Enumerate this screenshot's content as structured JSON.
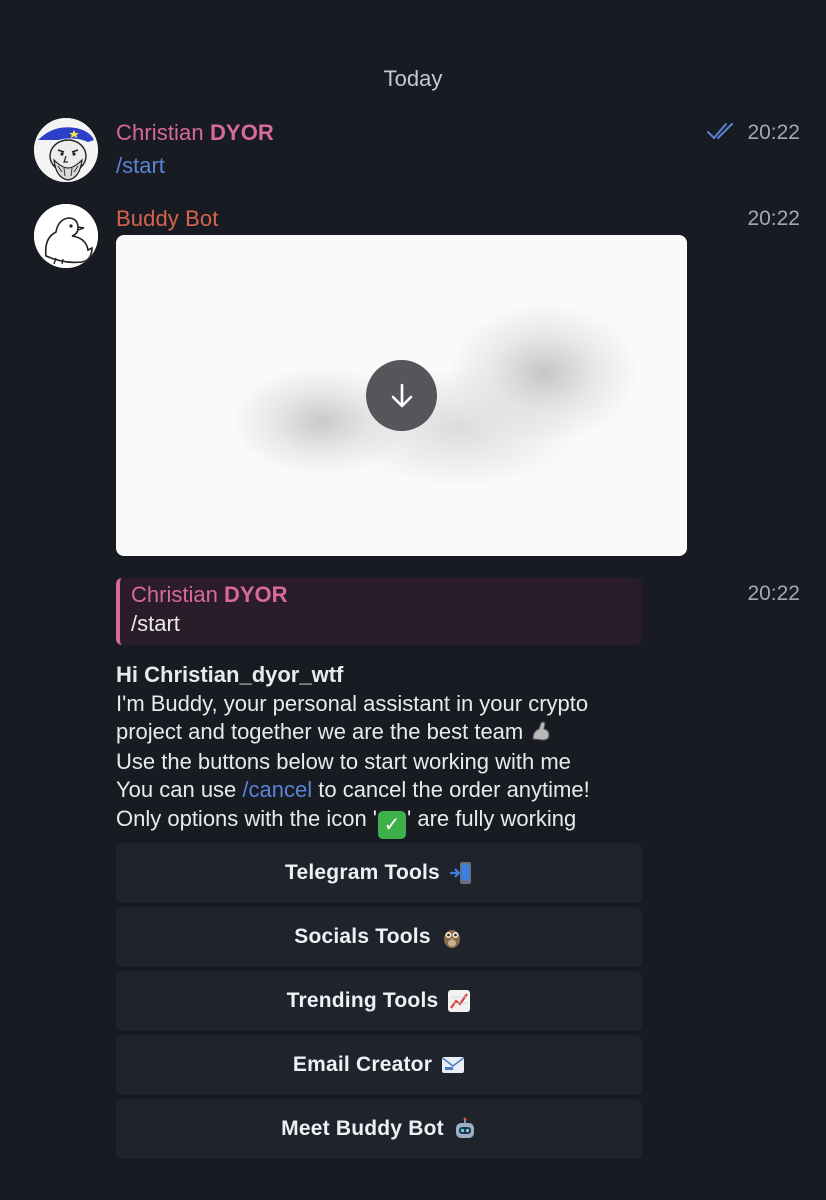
{
  "date_separator": "Today",
  "messages": [
    {
      "sender_name": "Christian",
      "sender_suffix": "DYOR",
      "text": "/start",
      "time": "20:22"
    },
    {
      "sender_name": "Buddy Bot",
      "time": "20:22",
      "media_time": "20:22"
    }
  ],
  "reply": {
    "name": "Christian",
    "suffix": "DYOR",
    "text": "/start"
  },
  "body": {
    "greeting": "Hi Christian_dyor_wtf",
    "line1": "I'm Buddy, your personal assistant in your crypto",
    "line2": "project and together we are the best team",
    "line3": "Use the buttons below to start working with me",
    "line4_pre": "You can use ",
    "line4_link": "/cancel",
    "line4_post": " to cancel the order anytime!",
    "line5_pre": "Only options with the icon '",
    "line5_post": "' are fully working"
  },
  "keyboard": [
    {
      "label": "Telegram Tools",
      "icon": "phone-arrow-icon"
    },
    {
      "label": "Socials Tools",
      "icon": "owl-icon"
    },
    {
      "label": "Trending Tools",
      "icon": "chart-up-icon"
    },
    {
      "label": "Email Creator",
      "icon": "email-icon"
    },
    {
      "label": "Meet Buddy Bot",
      "icon": "robot-icon"
    }
  ],
  "colors": {
    "background": "#181b22",
    "christian_name": "#d7699d",
    "bot_name": "#d8644f",
    "link": "#5a83d6",
    "button_bg": "#1f232c"
  }
}
